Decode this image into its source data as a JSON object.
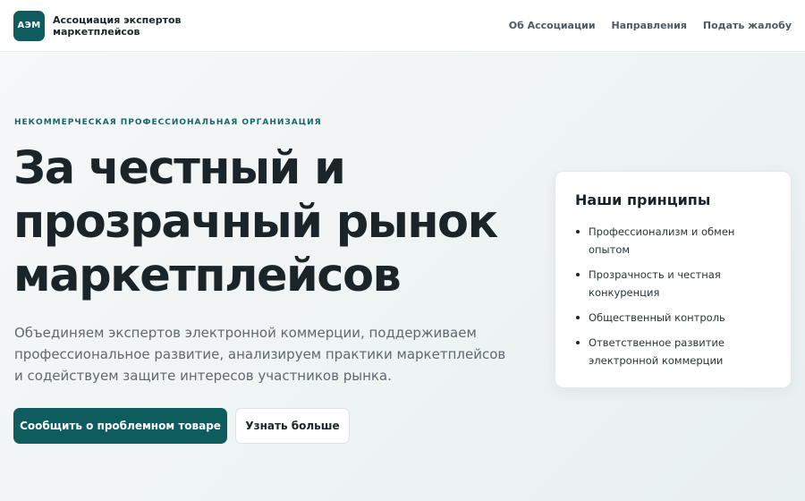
{
  "header": {
    "logo_text": "АЭМ",
    "brand_name": "Ассоциация экспертов маркетплейсов",
    "nav": [
      {
        "label": "Об Ассоциации"
      },
      {
        "label": "Направления"
      },
      {
        "label": "Подать жалобу"
      }
    ]
  },
  "hero": {
    "eyebrow": "Некоммерческая профессиональная организация",
    "title": "За честный и прозрачный рынок маркетплейсов",
    "lead": "Объединяем экспертов электронной коммерции, поддерживаем профессиональное развитие, анализируем практики маркетплейсов и содействуем защите интересов участников рынка.",
    "primary_button": "Сообщить о проблемном товаре",
    "secondary_button": "Узнать больше"
  },
  "principles": {
    "title": "Наши принципы",
    "items": [
      {
        "label": "Профессионализм и обмен опытом"
      },
      {
        "label": "Прозрачность и честная конкуренция"
      },
      {
        "label": "Общественный контроль"
      },
      {
        "label": "Ответственное развитие электронной коммерции"
      }
    ]
  },
  "colors": {
    "brand": "#0f5c5e",
    "eyebrow": "#16656a",
    "text": "#1b2428",
    "muted": "#5e6a70"
  }
}
